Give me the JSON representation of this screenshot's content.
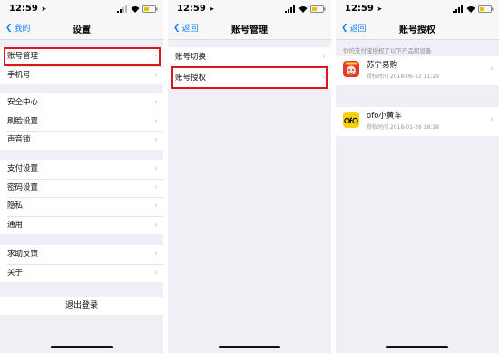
{
  "status": {
    "time": "12:59",
    "location_glyph": "➤"
  },
  "screens": [
    {
      "back": "我的",
      "title": "设置",
      "groups": [
        [
          "账号管理",
          "手机号"
        ],
        [
          "安全中心",
          "刷脸设置",
          "声音锁"
        ],
        [
          "支付设置",
          "密码设置",
          "隐私",
          "通用"
        ],
        [
          "求助反馈",
          "关于"
        ]
      ],
      "logout": "退出登录"
    },
    {
      "back": "返回",
      "title": "账号管理",
      "items": [
        "账号切换",
        "账号授权"
      ]
    },
    {
      "back": "返回",
      "title": "账号授权",
      "subheader": "你的支付宝授权了以下产品和设备",
      "apps": [
        {
          "name": "苏宁易购",
          "date": "授权时间 2018-06-12 11:29"
        },
        {
          "name": "ofo小黄车",
          "date": "授权时间 2018-01-26 18:18"
        }
      ]
    }
  ],
  "colors": {
    "accent": "#1b82f0",
    "highlight": "#e0141f",
    "suning_red": "#e8382f",
    "ofo_yellow": "#f5d10f"
  }
}
